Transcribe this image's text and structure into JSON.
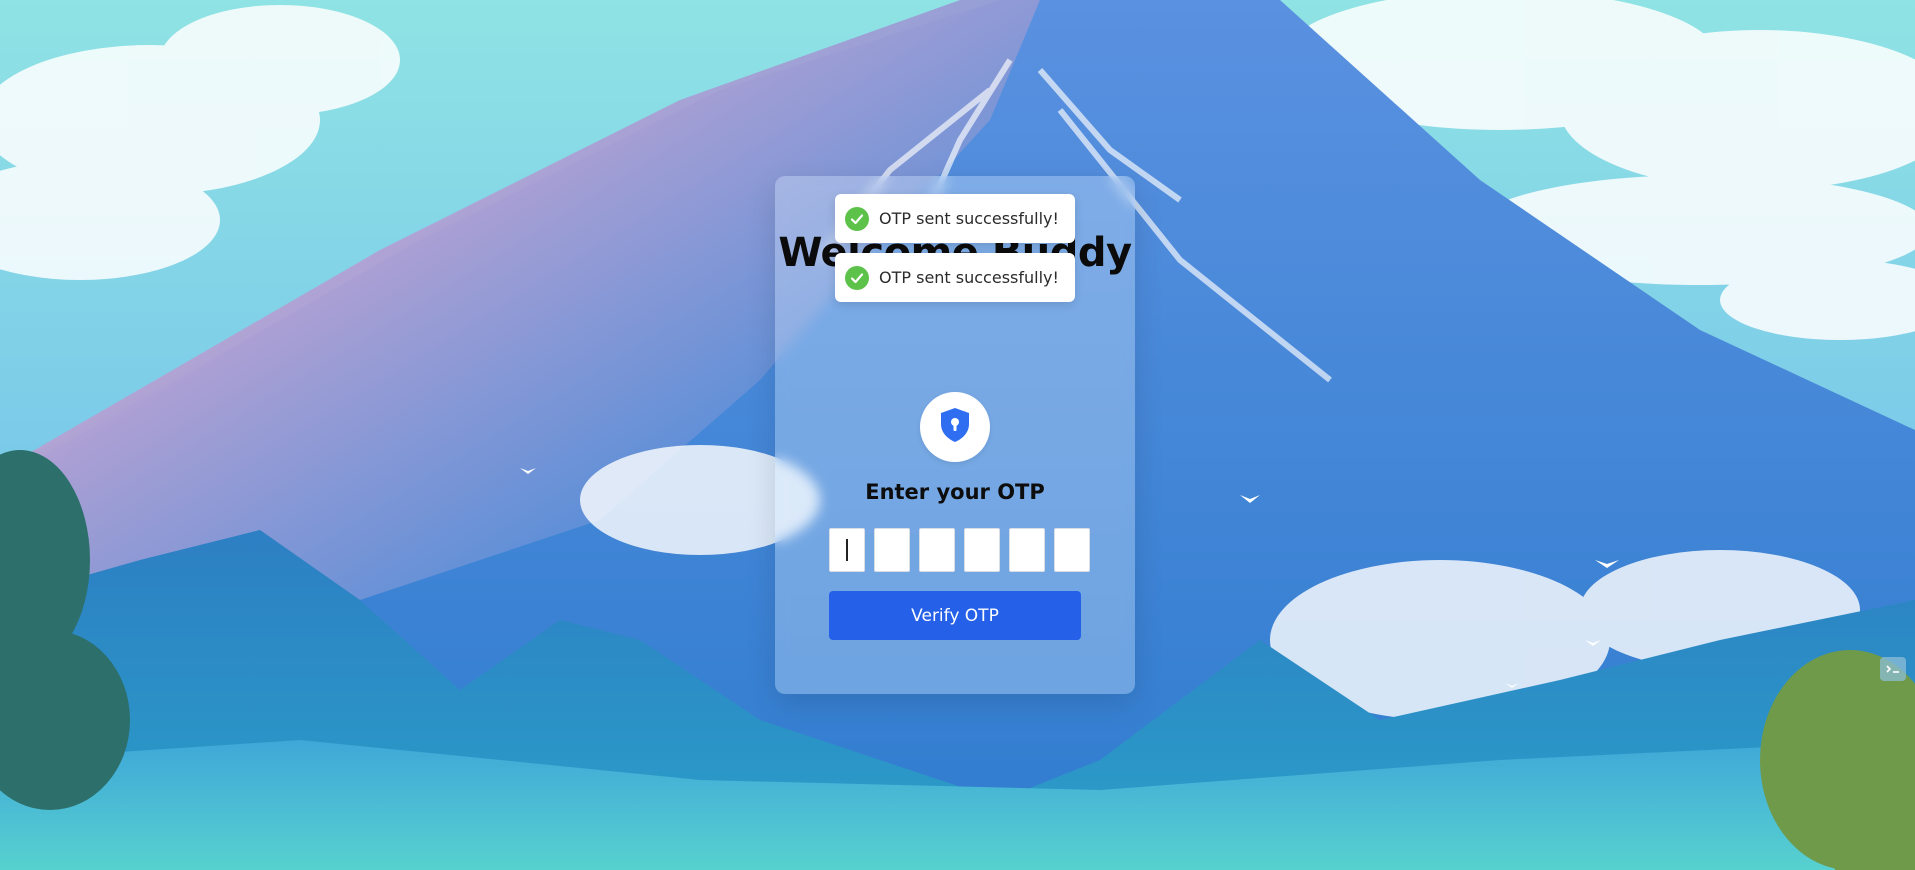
{
  "card": {
    "title": "Welcome Buddy",
    "otp_label": "Enter your OTP",
    "otp_digits": [
      "",
      "",
      "",
      "",
      "",
      ""
    ],
    "verify_label": "Verify OTP"
  },
  "toasts": [
    {
      "message": "OTP sent successfully!",
      "icon": "check-circle-icon",
      "color": "#5cc24a"
    },
    {
      "message": "OTP sent successfully!",
      "icon": "check-circle-icon",
      "color": "#5cc24a"
    }
  ],
  "icons": {
    "shield": "shield-keyhole-icon",
    "corner": "devtools-icon"
  },
  "colors": {
    "accent": "#2560e8",
    "shield": "#2f6ef0",
    "success": "#5cc24a"
  }
}
